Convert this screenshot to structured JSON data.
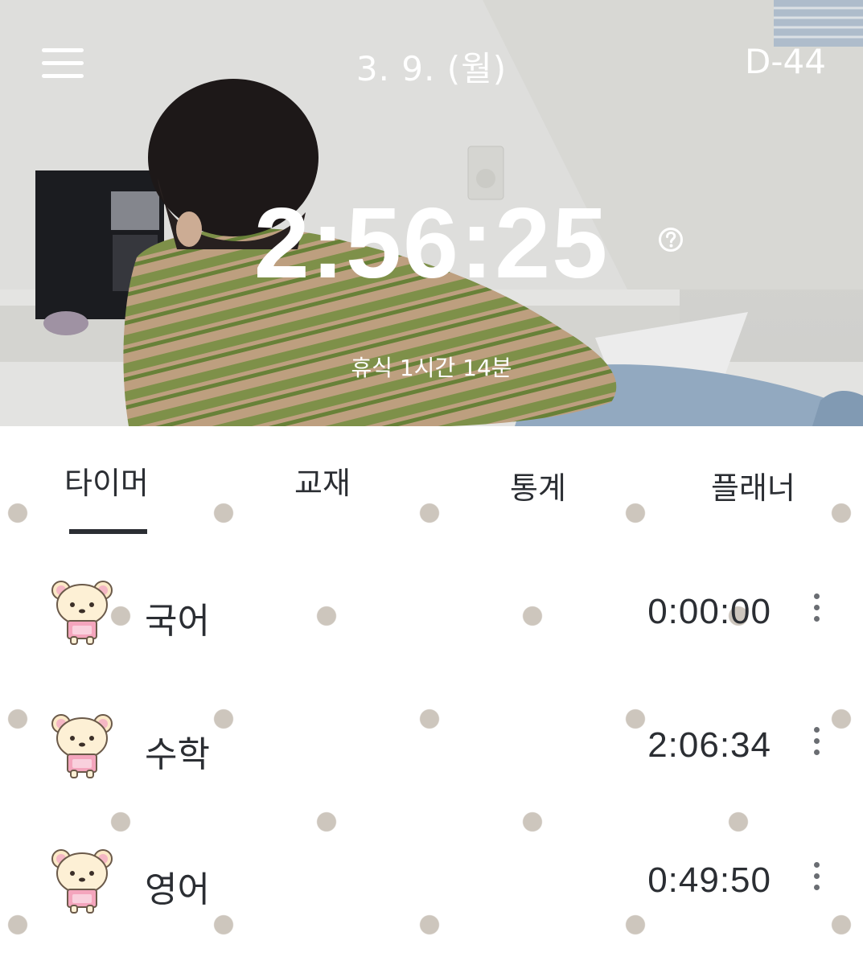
{
  "header": {
    "date": "3. 9. (월)",
    "dday": "D-44"
  },
  "timer": {
    "total": "2:56:25",
    "rest": "휴식 1시간 14분"
  },
  "tabs": [
    {
      "label": "타이머",
      "active": true
    },
    {
      "label": "교재",
      "active": false
    },
    {
      "label": "통계",
      "active": false
    },
    {
      "label": "플래너",
      "active": false
    }
  ],
  "subjects": [
    {
      "name": "국어",
      "time": "0:00:00",
      "icon": "bear-icon"
    },
    {
      "name": "수학",
      "time": "2:06:34",
      "icon": "bear-icon"
    },
    {
      "name": "영어",
      "time": "0:49:50",
      "icon": "bear-icon"
    }
  ],
  "colors": {
    "text": "#2b2e33",
    "dot_pattern": "#cdc6bd",
    "header_text": "#ffffff"
  }
}
